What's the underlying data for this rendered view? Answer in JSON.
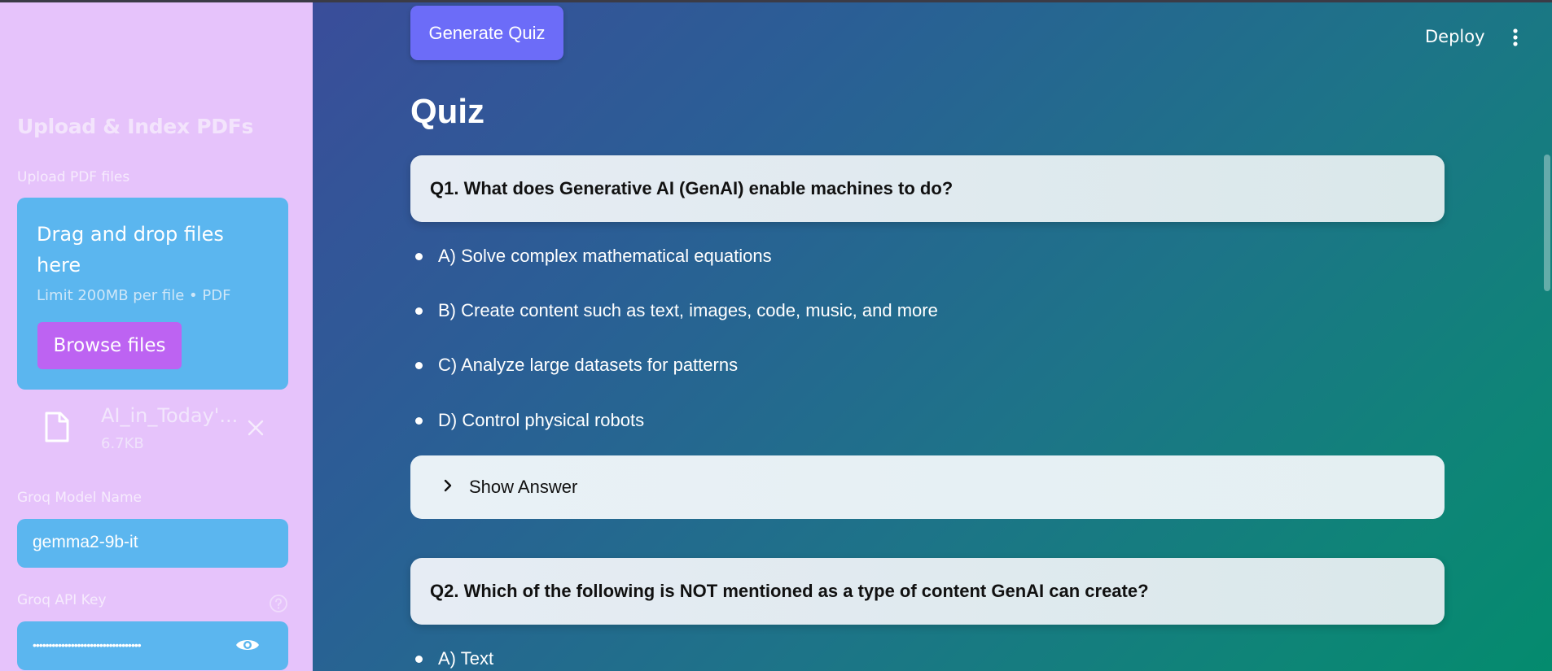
{
  "sidebar": {
    "title": "Upload & Index PDFs",
    "upload_label": "Upload PDF files",
    "dropzone": {
      "title": "Drag and drop files here",
      "limit": "Limit 200MB per file • PDF",
      "browse_label": "Browse files"
    },
    "file": {
      "name": "AI_in_Today'...",
      "size": "6.7KB"
    },
    "model_label": "Groq Model Name",
    "model_value": "gemma2-9b-it",
    "api_key_label": "Groq API Key",
    "api_key_value": "••••••••••••••••••••••••••••••••••"
  },
  "header": {
    "generate_label": "Generate Quiz",
    "deploy_label": "Deploy"
  },
  "main": {
    "title": "Quiz",
    "questions": [
      {
        "text": "Q1. What does Generative AI (GenAI) enable machines to do?",
        "options": [
          "A) Solve complex mathematical equations",
          "B) Create content such as text, images, code, music, and more",
          "C) Analyze large datasets for patterns",
          "D) Control physical robots"
        ],
        "show_answer_label": "Show Answer"
      },
      {
        "text": "Q2. Which of the following is NOT mentioned as a type of content GenAI can create?",
        "options": [
          "A) Text"
        ]
      }
    ]
  },
  "colors": {
    "sidebar_bg": "#e6c3fb",
    "input_bg": "#5bb6ef",
    "browse_button": "#bd63f2",
    "generate_button": "#6c6cf8",
    "main_gradient_start": "#3a4d9a",
    "main_gradient_end": "#048b6e"
  }
}
